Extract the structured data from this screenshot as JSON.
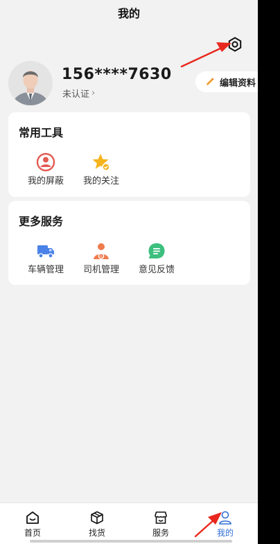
{
  "header": {
    "title": "我的"
  },
  "profile": {
    "phone": "156****7630",
    "auth_status": "未认证",
    "auth_chevron": "›",
    "edit_label": "编辑资料"
  },
  "common_tools": {
    "title": "常用工具",
    "items": [
      {
        "label": "我的屏蔽",
        "icon": "blocked-user-icon"
      },
      {
        "label": "我的关注",
        "icon": "star-follow-icon"
      }
    ]
  },
  "more_services": {
    "title": "更多服务",
    "items": [
      {
        "label": "车辆管理",
        "icon": "truck-icon"
      },
      {
        "label": "司机管理",
        "icon": "driver-icon"
      },
      {
        "label": "意见反馈",
        "icon": "feedback-icon"
      }
    ]
  },
  "tabbar": {
    "items": [
      {
        "label": "首页",
        "icon": "home-icon"
      },
      {
        "label": "找货",
        "icon": "box-icon"
      },
      {
        "label": "服务",
        "icon": "store-icon"
      },
      {
        "label": "我的",
        "icon": "person-icon",
        "active": true
      }
    ]
  },
  "colors": {
    "accent": "#2f6fd6",
    "annotation_arrow": "#e8281e"
  }
}
